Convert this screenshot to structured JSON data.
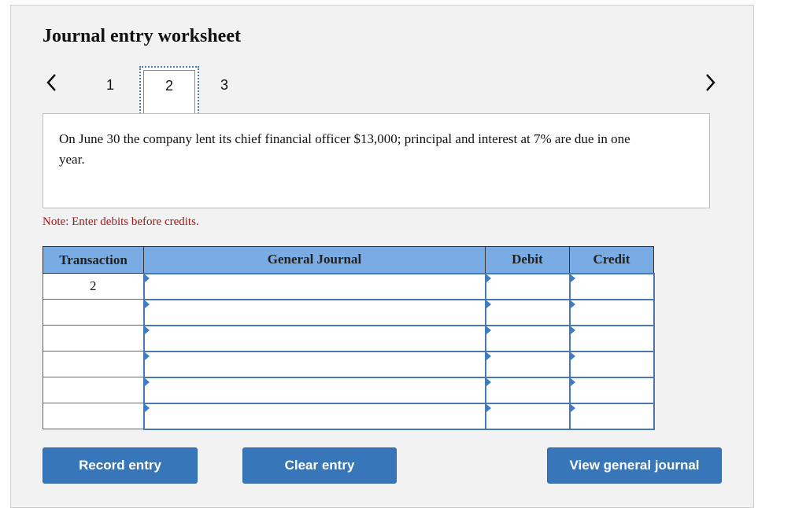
{
  "worksheet": {
    "title": "Journal entry worksheet",
    "pages": [
      "1",
      "2",
      "3"
    ],
    "current_page": "2",
    "question": "On June 30 the company lent its chief financial officer $13,000; principal and interest at 7% are due in one year.",
    "note": "Note: Enter debits before credits."
  },
  "table": {
    "headers": {
      "transaction": "Transaction",
      "general_journal": "General Journal",
      "debit": "Debit",
      "credit": "Credit"
    },
    "rows": [
      {
        "transaction": "2",
        "account": "",
        "debit": "",
        "credit": ""
      },
      {
        "transaction": "",
        "account": "",
        "debit": "",
        "credit": ""
      },
      {
        "transaction": "",
        "account": "",
        "debit": "",
        "credit": ""
      },
      {
        "transaction": "",
        "account": "",
        "debit": "",
        "credit": ""
      },
      {
        "transaction": "",
        "account": "",
        "debit": "",
        "credit": ""
      },
      {
        "transaction": "",
        "account": "",
        "debit": "",
        "credit": ""
      }
    ]
  },
  "buttons": {
    "record": "Record entry",
    "clear": "Clear entry",
    "view": "View general journal"
  },
  "icons": {
    "prev": "chevron-left-icon",
    "next": "chevron-right-icon"
  },
  "colors": {
    "header_bg": "#79ace4",
    "button_bg": "#3876ba",
    "note_text": "#a0161a",
    "focus_outline": "#3d7cc9"
  }
}
